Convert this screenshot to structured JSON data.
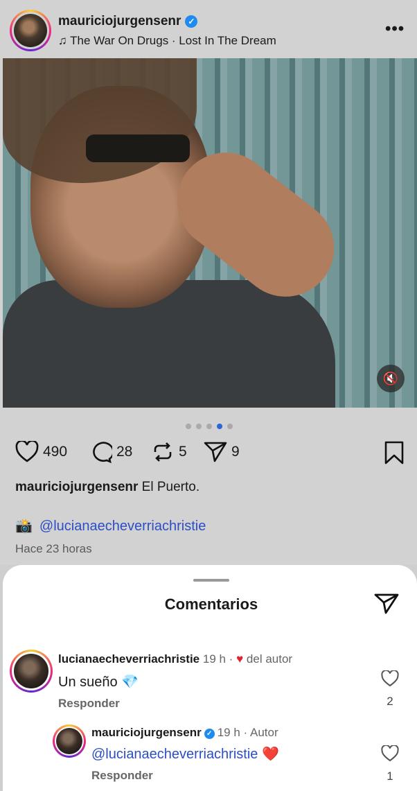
{
  "post": {
    "username": "mauriciojurgensenr",
    "music": "The War On Drugs · Lost In The Dream",
    "likes": "490",
    "comments": "28",
    "reposts": "5",
    "shares": "9",
    "caption_user": "mauriciojurgensenr",
    "caption_text": "El Puerto.",
    "photo_credit": "@lucianaecheverriachristie",
    "time": "Hace 23 horas",
    "carousel_index": 4,
    "carousel_total": 5
  },
  "sheet": {
    "title": "Comentarios"
  },
  "comments": [
    {
      "user": "lucianaecheverriachristie",
      "meta_time": "19 h ·",
      "meta_tag": "del autor",
      "text": "Un sueño",
      "reply": "Responder",
      "likes": "2"
    },
    {
      "user": "mauriciojurgensenr",
      "meta_time": "19 h · Autor",
      "mention": "@lucianaecheverriachristie",
      "reply": "Responder",
      "likes": "1"
    }
  ],
  "icons": {
    "menu": "more-icon",
    "mute": "mute-icon",
    "like": "heart-icon",
    "comment": "comment-icon",
    "repost": "repost-icon",
    "share": "share-icon",
    "save": "bookmark-icon"
  }
}
